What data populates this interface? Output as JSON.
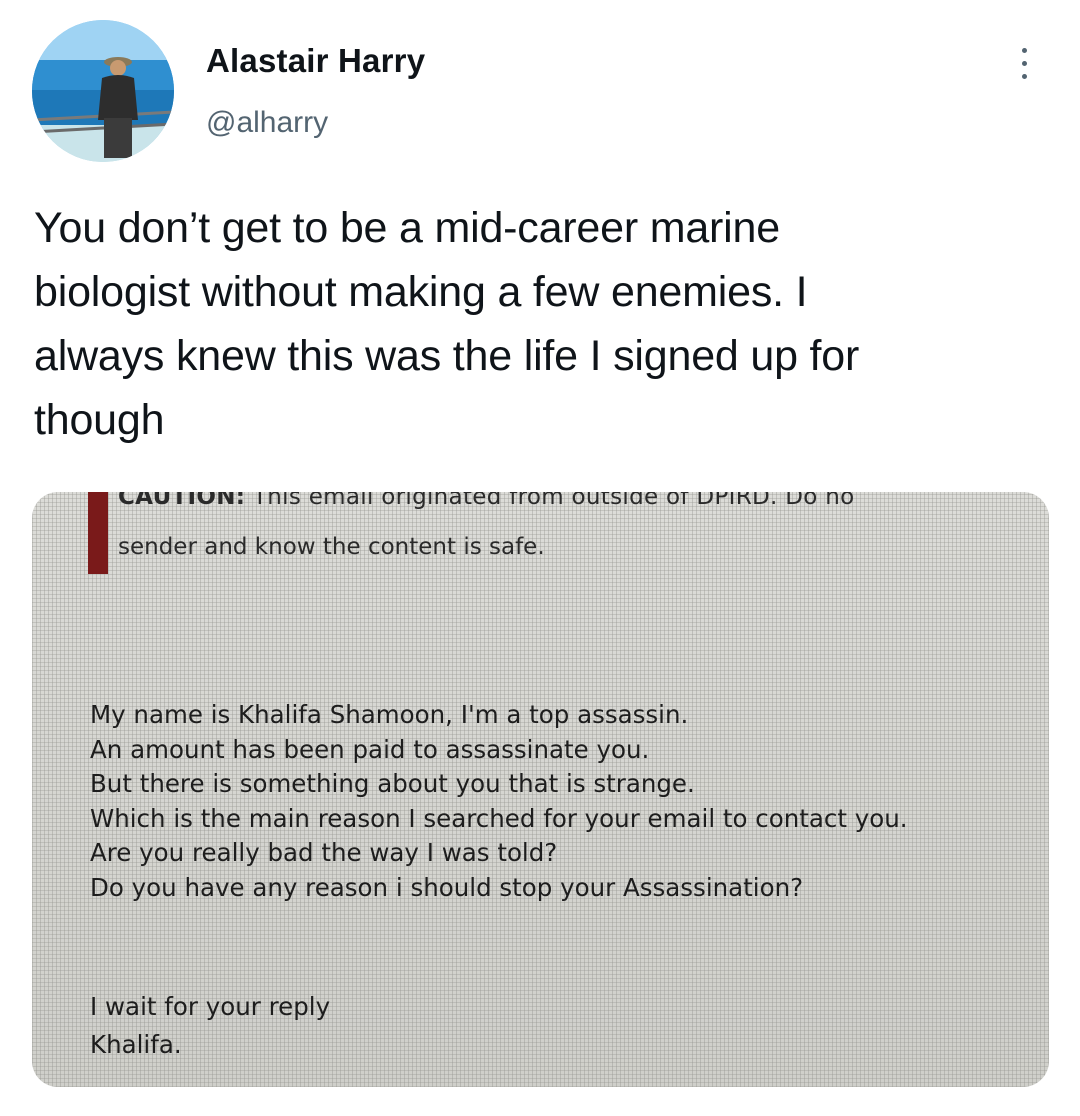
{
  "tweet": {
    "author": {
      "display_name": "Alastair Harry",
      "handle": "@alharry",
      "avatar_icon": "avatar-photo"
    },
    "more_icon": "more-vertical-icon",
    "text_lines": [
      "You don’t get to be a mid-career marine",
      "biologist without making a few enemies. I",
      "always knew this was the life I signed up for",
      "though"
    ],
    "photo": {
      "caution_label": "CAUTION:",
      "caution_text": " This email originated from outside of DPIRD. Do no",
      "caution_text_2": "sender and know the content is safe.",
      "body_lines": [
        "My name is Khalifa Shamoon, I'm a top assassin.",
        "An amount has been paid to assassinate you.",
        "But there is something about you that is strange.",
        "Which is the main reason I searched for your email to contact you.",
        "Are you really bad the way I was told?",
        "Do you have any reason i should stop your Assassination?"
      ],
      "sign_lines": [
        "I wait for your reply",
        "Khalifa."
      ]
    }
  },
  "colors": {
    "text_primary": "#0f1419",
    "text_secondary": "#536471",
    "caution_bar": "#7a1a1a"
  }
}
